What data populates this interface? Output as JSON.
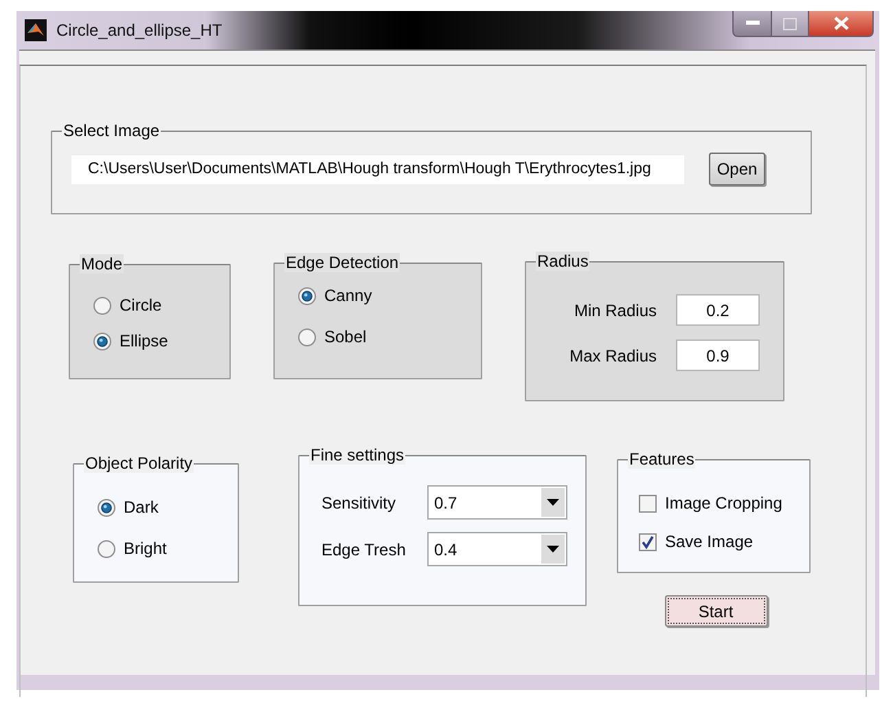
{
  "window": {
    "title": "Circle_and_ellipse_HT"
  },
  "select_image": {
    "title": "Select Image",
    "path": "C:\\Users\\User\\Documents\\MATLAB\\Hough transform\\Hough T\\Erythrocytes1.jpg",
    "button": "Open"
  },
  "mode": {
    "title": "Mode",
    "options": [
      {
        "label": "Circle",
        "selected": false
      },
      {
        "label": "Ellipse",
        "selected": true
      }
    ]
  },
  "edge_detection": {
    "title": "Edge Detection",
    "options": [
      {
        "label": "Canny",
        "selected": true
      },
      {
        "label": "Sobel",
        "selected": false
      }
    ]
  },
  "radius": {
    "title": "Radius",
    "fields": [
      {
        "label": "Min Radius",
        "value": "0.2"
      },
      {
        "label": "Max Radius",
        "value": "0.9"
      }
    ]
  },
  "object_polarity": {
    "title": "Object Polarity",
    "options": [
      {
        "label": "Dark",
        "selected": true
      },
      {
        "label": "Bright",
        "selected": false
      }
    ]
  },
  "fine_settings": {
    "title": "Fine settings",
    "fields": [
      {
        "label": "Sensitivity",
        "value": "0.7"
      },
      {
        "label": "Edge Tresh",
        "value": "0.4"
      }
    ]
  },
  "features": {
    "title": "Features",
    "options": [
      {
        "label": "Image Cropping",
        "checked": false
      },
      {
        "label": "Save Image",
        "checked": true
      }
    ]
  },
  "start_button": "Start"
}
